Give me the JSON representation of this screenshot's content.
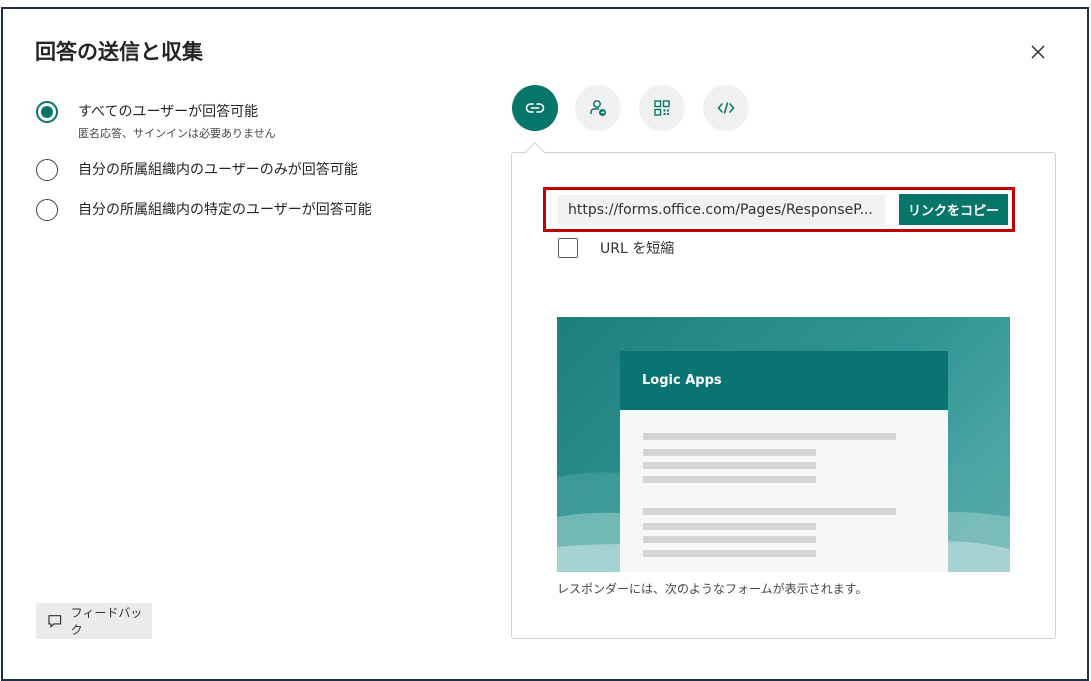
{
  "dialog": {
    "title": "回答の送信と収集",
    "close_icon": "close-icon"
  },
  "audience": {
    "options": [
      {
        "label": "すべてのユーザーが回答可能",
        "sub": "匿名応答、サインインは必要ありません",
        "selected": true
      },
      {
        "label": "自分の所属組織内のユーザーのみが回答可能",
        "selected": false
      },
      {
        "label": "自分の所属組織内の特定のユーザーが回答可能",
        "selected": false
      }
    ]
  },
  "share_tabs": [
    {
      "icon": "link-icon",
      "active": true
    },
    {
      "icon": "invite-person-icon",
      "active": false
    },
    {
      "icon": "qr-code-icon",
      "active": false
    },
    {
      "icon": "embed-code-icon",
      "active": false
    }
  ],
  "link": {
    "url": "https://forms.office.com/Pages/ResponseP...",
    "copy_label": "リンクをコピー"
  },
  "shorten": {
    "label": "URL を短縮",
    "checked": false
  },
  "preview": {
    "form_title": "Logic Apps",
    "caption": "レスポンダーには、次のようなフォームが表示されます。"
  },
  "feedback": {
    "label": "フィードバック"
  },
  "colors": {
    "accent": "#077568",
    "highlight_border": "#c00000",
    "dialog_border": "#1f2f4a"
  }
}
